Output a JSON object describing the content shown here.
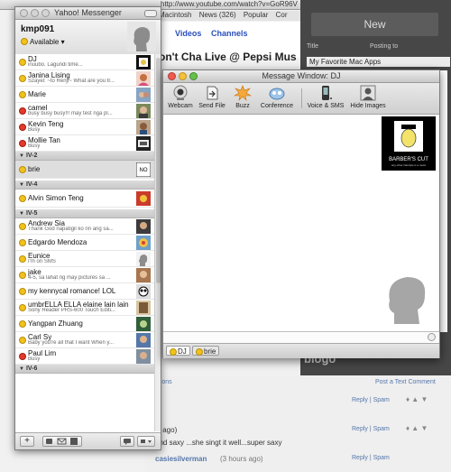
{
  "background": {
    "url_text": "http://www.youtube.com/watch?v=GoR96V",
    "bookmarks": [
      "Macintosh",
      "News (326)",
      "Popular",
      "Cor"
    ],
    "nav_links": [
      "Videos",
      "Channels"
    ],
    "video_title": "on't Cha Live @ Pepsi Mus",
    "blog_new_button": "New",
    "blog_title_label": "Title",
    "blog_posting_to": "Posting to",
    "blog_title_value": "My Favorite Mac Apps",
    "blogo_logo": "blogo",
    "post_comment": "Post a Text Comment",
    "options_link": "ptions",
    "reply_spam": "Reply | Spam",
    "comment_ago": "s ago)",
    "comment_text": "and saxy ...she singt it well...super saxy",
    "commenter": "casiesilverman",
    "commenter_time": "(3 hours ago)"
  },
  "messenger": {
    "title": "Yahoo! Messenger",
    "username": "kmp091",
    "status": "Available",
    "groups": {
      "g2": "IV-2",
      "g4": "IV-4",
      "g5": "IV-5",
      "g6": "IV-6"
    },
    "buddies": {
      "dj": {
        "name": "DJ",
        "status": "inuubo. Lagundi time..."
      },
      "janina": {
        "name": "Janina Lising",
        "status": "Szayel: ~to Renji~ What are you tr..."
      },
      "marie": {
        "name": "Marie",
        "status": ""
      },
      "camel": {
        "name": "camel",
        "status": "busy busy busy!!! may test nga pl..."
      },
      "kevin": {
        "name": "Kevin Teng",
        "status": "Busy"
      },
      "mollie": {
        "name": "Mollie Tan",
        "status": "Busy"
      },
      "brie": {
        "name": "brie",
        "status": ""
      },
      "alvin": {
        "name": "Alvin Simon Teng",
        "status": ""
      },
      "andrew": {
        "name": "Andrew Sia",
        "status": "Thank God napatigil ko rin ang sa..."
      },
      "edgardo": {
        "name": "Edgardo Mendoza",
        "status": ""
      },
      "eunice": {
        "name": "Eunice",
        "status": "I'm on SMS"
      },
      "jake": {
        "name": "jake",
        "status": "4-5, sa lahat ng may pictures sa ..."
      },
      "kennycal": {
        "name": "my kennycal romance! LOL",
        "status": ""
      },
      "umbrella": {
        "name": "umbrELLA ELLA elaine lain lain",
        "status": "Sony Reader PRS-600 Touch Editi..."
      },
      "yangpan": {
        "name": "Yangpan Zhuang",
        "status": ""
      },
      "carl": {
        "name": "Carl Sy",
        "status": "Baby you're all that I want When y..."
      },
      "paul": {
        "name": "Paul Lim",
        "status": "Busy"
      }
    }
  },
  "message_window": {
    "title": "Message Window: DJ",
    "toolbar": {
      "webcam": "Webcam",
      "send_file": "Send File",
      "buzz": "Buzz",
      "conference": "Conference",
      "voice_sms": "Voice & SMS",
      "hide_images": "Hide Images"
    },
    "dj_avatar_text_1": "BARBER'S CUT",
    "dj_avatar_text_2": "any other hairstyle is a mess",
    "input_value": "",
    "tabs": [
      "DJ",
      "brie"
    ]
  },
  "colors": {
    "available": "#f1c21c",
    "busy": "#e23a2b",
    "link": "#2a4fbd"
  }
}
